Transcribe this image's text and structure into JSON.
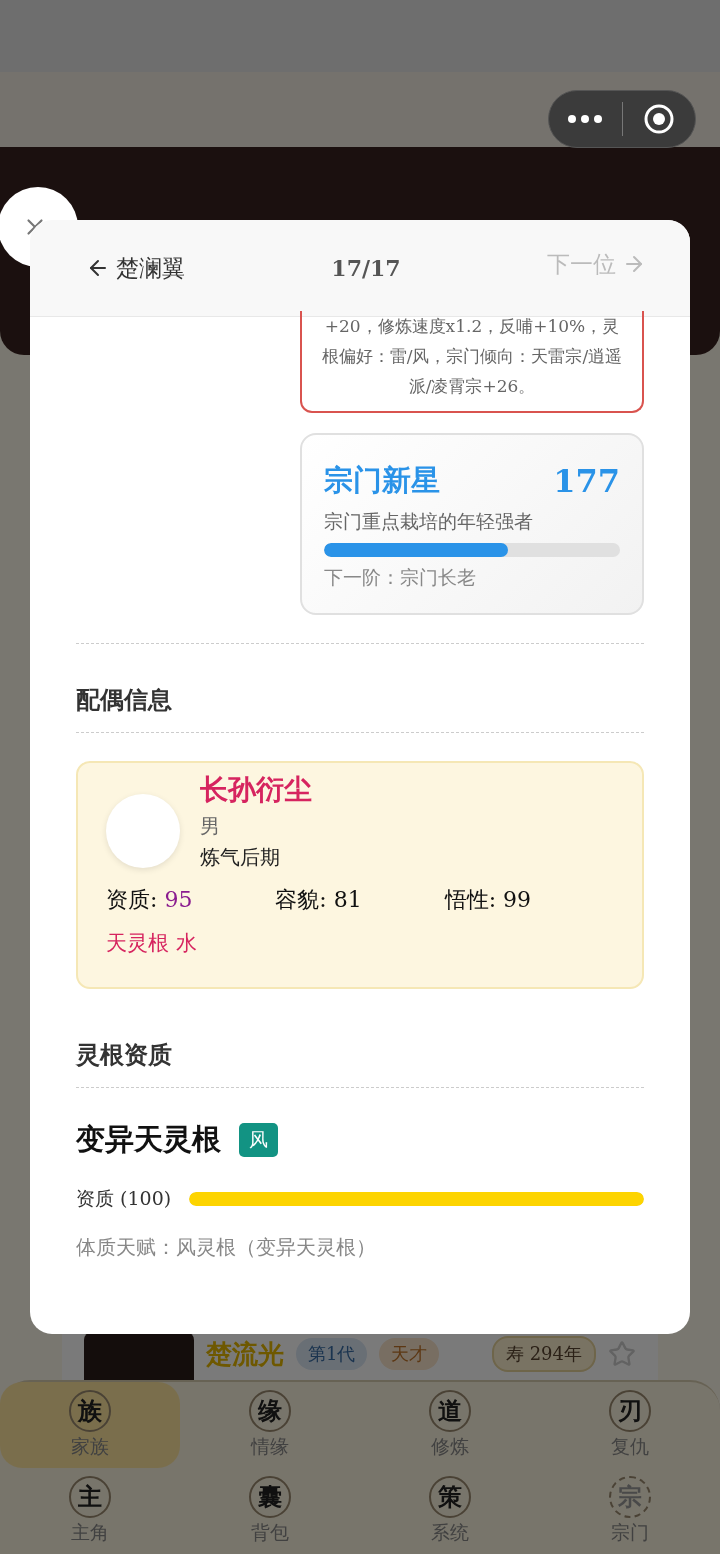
{
  "background": {
    "list_item": {
      "name": "楚流光",
      "generation": "第1代",
      "tag": "天才",
      "lifespan": "寿 294年",
      "starred": false
    },
    "bottom_nav": [
      {
        "glyph": "族",
        "label": "家族",
        "selected": true,
        "disabled": false
      },
      {
        "glyph": "缘",
        "label": "情缘",
        "selected": false,
        "disabled": false
      },
      {
        "glyph": "道",
        "label": "修炼",
        "selected": false,
        "disabled": false
      },
      {
        "glyph": "刃",
        "label": "复仇",
        "selected": false,
        "disabled": false
      },
      {
        "glyph": "主",
        "label": "主角",
        "selected": false,
        "disabled": false
      },
      {
        "glyph": "囊",
        "label": "背包",
        "selected": false,
        "disabled": false
      },
      {
        "glyph": "策",
        "label": "系统",
        "selected": false,
        "disabled": false
      },
      {
        "glyph": "宗",
        "label": "宗门",
        "selected": false,
        "disabled": true
      }
    ]
  },
  "modal": {
    "prev_label": "楚澜翼",
    "counter": "17/17",
    "next_label": "下一位",
    "next_disabled": true,
    "trait_text": "+20，修炼速度x1.2，反哺+10%，灵根偏好：雷/风，宗门倾向：天雷宗/逍遥派/凌霄宗+26。",
    "rank_card": {
      "title": "宗门新星",
      "score": "177",
      "description": "宗门重点栽培的年轻强者",
      "level": 0.62,
      "next": "下一阶：宗门长老"
    },
    "spouse_section": {
      "title": "配偶信息",
      "name": "长孙衍尘",
      "gender": "男",
      "realm": "炼气后期",
      "stats": [
        {
          "label": "资质:",
          "value": "95",
          "color": "#8a1b8f"
        },
        {
          "label": "容貌:",
          "value": "81",
          "color": "#111111"
        },
        {
          "label": "悟性:",
          "value": "99",
          "color": "#111111"
        }
      ],
      "root": "天灵根 水"
    },
    "root_section": {
      "title": "灵根资质",
      "root_name": "变异天灵根",
      "element": "风",
      "aptitude_label": "资质 (100)",
      "level": 1,
      "constitution": "体质天赋：风灵根（变异天灵根）"
    }
  }
}
